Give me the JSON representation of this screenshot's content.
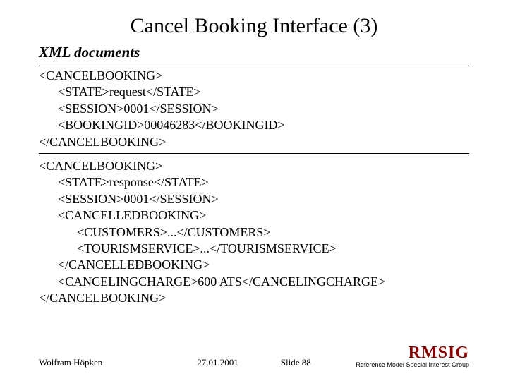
{
  "title": "Cancel Booking Interface (3)",
  "subtitle": "XML documents",
  "xml_request": "<CANCELBOOKING>\n      <STATE>request</STATE>\n      <SESSION>0001</SESSION>\n      <BOOKINGID>00046283</BOOKINGID>\n</CANCELBOOKING>",
  "xml_response": "<CANCELBOOKING>\n      <STATE>response</STATE>\n      <SESSION>0001</SESSION>\n      <CANCELLEDBOOKING>\n            <CUSTOMERS>...</CUSTOMERS>\n            <TOURISMSERVICE>...</TOURISMSERVICE>\n      </CANCELLEDBOOKING>\n      <CANCELINGCHARGE>600 ATS</CANCELINGCHARGE>\n</CANCELBOOKING>",
  "footer": {
    "author": "Wolfram Höpken",
    "date": "27.01.2001",
    "slide": "Slide 88",
    "logo": "RMSIG",
    "logo_sub": "Reference Model Special Interest Group"
  }
}
